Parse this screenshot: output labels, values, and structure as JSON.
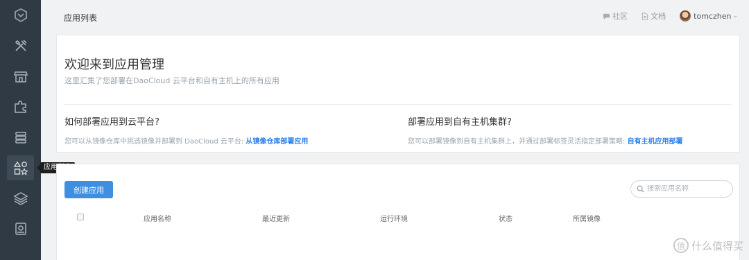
{
  "sidebar": {
    "items": [
      {
        "icon": "logo-icon"
      },
      {
        "icon": "tools-icon"
      },
      {
        "icon": "store-icon"
      },
      {
        "icon": "puzzle-icon"
      },
      {
        "icon": "server-icon"
      },
      {
        "icon": "apps-icon",
        "active": true
      },
      {
        "icon": "layers-icon"
      },
      {
        "icon": "disk-icon"
      }
    ],
    "tooltip": "应用列表"
  },
  "header": {
    "title": "应用列表",
    "community": "社区",
    "docs": "文档",
    "user": "tomczhen"
  },
  "welcome": {
    "title": "欢迎来到应用管理",
    "subtitle": "这里汇集了您部署在DaoCloud 云平台和自有主机上的所有应用",
    "left": {
      "heading": "如何部署应用到云平台?",
      "text": "您可以从镜像仓库中挑选镜像并部署到 DaoCloud 云平台: ",
      "link": "从镜像仓库部署应用"
    },
    "right": {
      "heading": "部署应用到自有主机集群?",
      "text": "您可以部署镜像到自有主机集群上，并通过部署标签灵活指定部署策略: ",
      "link": "自有主机应用部署"
    }
  },
  "apps": {
    "create_label": "创建应用",
    "search_placeholder": "搜索应用名称",
    "columns": [
      "应用名称",
      "最近更新",
      "运行环境",
      "状态",
      "所属镜像"
    ]
  },
  "watermark": "什么值得买",
  "colors": {
    "sidebar": "#2f3a44",
    "accent": "#3d8fe0",
    "link": "#2d80ec"
  }
}
